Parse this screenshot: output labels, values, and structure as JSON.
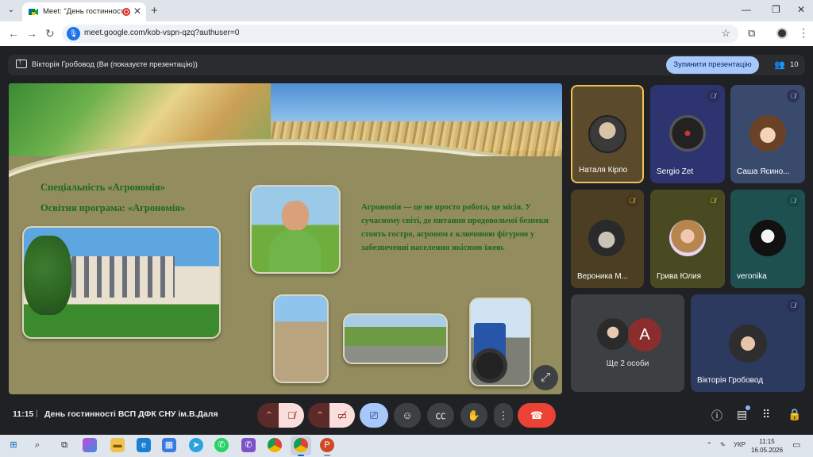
{
  "browser": {
    "tab_title": "Meet: \"День гостинності В",
    "url": "meet.google.com/kob-vspn-qzq?authuser=0"
  },
  "presentation_bar": {
    "text": "Вікторія Гробовод (Ви (показуєте презентацію))",
    "stop_button": "Зупинити презентацію",
    "participants_count": "10"
  },
  "slide": {
    "specialty": "Спеціальність  «Агрономія»",
    "program": "Освітня програма: «Агрономія»",
    "description": "Агрономія — це не просто робота, це місія. У сучасному світі, де питання продовольчої безпеки стоять гостро, агроном є ключовою фігурою у забезпеченні населення якісною їжею."
  },
  "participants": [
    {
      "name": "Наталя Кірпо",
      "muted": false
    },
    {
      "name": "Sergio Zet",
      "muted": true
    },
    {
      "name": "Саша Ясино...",
      "muted": true
    },
    {
      "name": "Вероника М...",
      "muted": true
    },
    {
      "name": "Грива Юлия",
      "muted": true
    },
    {
      "name": "veronika",
      "muted": true
    },
    {
      "name": "Вікторія Гробовод",
      "muted": true
    }
  ],
  "more_people": {
    "label": "Ще 2 особи",
    "avatar_letter": "A"
  },
  "meeting": {
    "time": "11:15",
    "separator": "|",
    "title": "День гостинності ВСП ДФК СНУ ім.В.Даля"
  },
  "taskbar": {
    "language": "УКР",
    "clock_time": "11:15",
    "clock_date": "16.05.2026"
  },
  "colors": {
    "slide_bg": "#938c5e",
    "slide_text": "#1a6b1a",
    "stop_button": "#a8c7fa",
    "end_call": "#ea4335",
    "active_speaker_border": "#f2c14e"
  }
}
